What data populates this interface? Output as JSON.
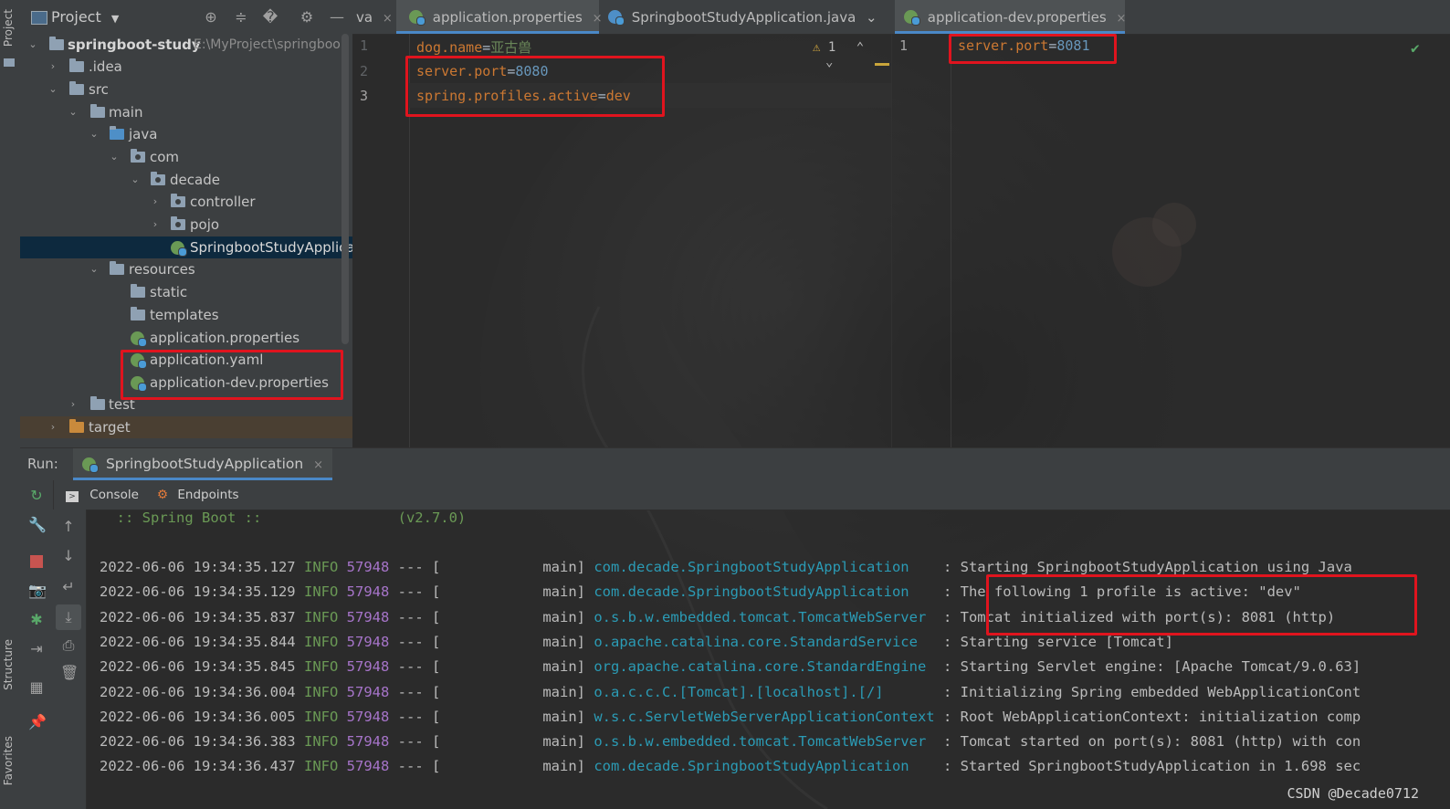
{
  "sidebar": {
    "project_tab": "Project",
    "structure_tab": "Structure",
    "favorites_tab": "Favorites"
  },
  "project_panel": {
    "title": "Project",
    "root_name": "springboot-study",
    "root_path": "E:\\MyProject\\springboo",
    "items": [
      {
        "label": ".idea"
      },
      {
        "label": "src"
      },
      {
        "label": "main"
      },
      {
        "label": "java"
      },
      {
        "label": "com"
      },
      {
        "label": "decade"
      },
      {
        "label": "controller"
      },
      {
        "label": "pojo"
      },
      {
        "label": "SpringbootStudyApplica"
      },
      {
        "label": "resources"
      },
      {
        "label": "static"
      },
      {
        "label": "templates"
      },
      {
        "label": "application.properties"
      },
      {
        "label": "application.yaml"
      },
      {
        "label": "application-dev.properties"
      },
      {
        "label": "test"
      },
      {
        "label": "target"
      }
    ]
  },
  "tabs": {
    "partial": "va",
    "tab1": "application.properties",
    "tab2": "SpringbootStudyApplication.java",
    "tab3": "application-dev.properties",
    "close": "×"
  },
  "editor_left": {
    "warning_count": "1",
    "lines": [
      {
        "num": "1",
        "key": "dog.name",
        "value": "亚古兽"
      },
      {
        "num": "2",
        "key": "server.port",
        "value": "8080"
      },
      {
        "num": "3",
        "key": "spring.profiles.active",
        "value": "dev"
      }
    ]
  },
  "editor_right": {
    "lines": [
      {
        "num": "1",
        "key": "server.port",
        "value": "8081"
      }
    ]
  },
  "run_panel": {
    "label": "Run:",
    "config_name": "SpringbootStudyApplication",
    "close": "×",
    "console_tab": "Console",
    "endpoints_tab": "Endpoints",
    "banner": "  :: Spring Boot ::                (v2.7.0)",
    "logs": [
      {
        "ts": "2022-06-06 19:34:35.127",
        "level": "INFO",
        "pid": "57948",
        "sep": "--- [",
        "thread": "           main]",
        "logger": "com.decade.SpringbootStudyApplication   ",
        "msg": " : Starting SpringbootStudyApplication using Java"
      },
      {
        "ts": "2022-06-06 19:34:35.129",
        "level": "INFO",
        "pid": "57948",
        "sep": "--- [",
        "thread": "           main]",
        "logger": "com.decade.SpringbootStudyApplication   ",
        "msg": " : The following 1 profile is active: \"dev\""
      },
      {
        "ts": "2022-06-06 19:34:35.837",
        "level": "INFO",
        "pid": "57948",
        "sep": "--- [",
        "thread": "           main]",
        "logger": "o.s.b.w.embedded.tomcat.TomcatWebServer ",
        "msg": " : Tomcat initialized with port(s): 8081 (http)"
      },
      {
        "ts": "2022-06-06 19:34:35.844",
        "level": "INFO",
        "pid": "57948",
        "sep": "--- [",
        "thread": "           main]",
        "logger": "o.apache.catalina.core.StandardService  ",
        "msg": " : Starting service [Tomcat]"
      },
      {
        "ts": "2022-06-06 19:34:35.845",
        "level": "INFO",
        "pid": "57948",
        "sep": "--- [",
        "thread": "           main]",
        "logger": "org.apache.catalina.core.StandardEngine ",
        "msg": " : Starting Servlet engine: [Apache Tomcat/9.0.63]"
      },
      {
        "ts": "2022-06-06 19:34:36.004",
        "level": "INFO",
        "pid": "57948",
        "sep": "--- [",
        "thread": "           main]",
        "logger": "o.a.c.c.C.[Tomcat].[localhost].[/]      ",
        "msg": " : Initializing Spring embedded WebApplicationCont"
      },
      {
        "ts": "2022-06-06 19:34:36.005",
        "level": "INFO",
        "pid": "57948",
        "sep": "--- [",
        "thread": "           main]",
        "logger": "w.s.c.ServletWebServerApplicationContext",
        "msg": " : Root WebApplicationContext: initialization comp"
      },
      {
        "ts": "2022-06-06 19:34:36.383",
        "level": "INFO",
        "pid": "57948",
        "sep": "--- [",
        "thread": "           main]",
        "logger": "o.s.b.w.embedded.tomcat.TomcatWebServer ",
        "msg": " : Tomcat started on port(s): 8081 (http) with con"
      },
      {
        "ts": "2022-06-06 19:34:36.437",
        "level": "INFO",
        "pid": "57948",
        "sep": "--- [",
        "thread": "           main]",
        "logger": "com.decade.SpringbootStudyApplication   ",
        "msg": " : Started SpringbootStudyApplication in 1.698 sec"
      }
    ]
  },
  "watermark": "CSDN @Decade0712",
  "colors": {
    "highlight_box": "#e0141e",
    "accent_tab": "#4a88c7",
    "property_key": "#cc7832",
    "property_number": "#6897bb",
    "logger": "#2b9bb5",
    "info_level": "#6a9955"
  },
  "icons": {
    "project": "folder-icon",
    "locate": "crosshair-icon",
    "expand": "expand-all-icon",
    "collapse": "collapse-all-icon",
    "settings": "gear-icon",
    "hide": "minimize-icon",
    "rerun": "rerun-icon",
    "stop": "stop-icon"
  }
}
